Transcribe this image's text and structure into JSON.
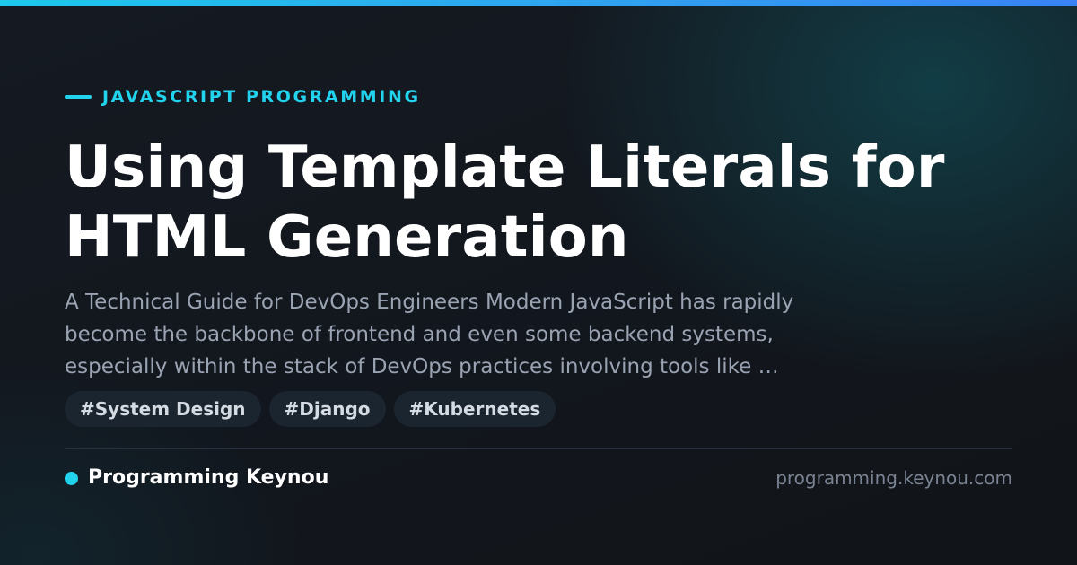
{
  "category": "JAVASCRIPT PROGRAMMING",
  "title_lines": [
    "Using Template Literals for",
    "HTML Generation"
  ],
  "excerpt_lines": [
    "A Technical Guide for DevOps Engineers Modern JavaScript has rapidly",
    "become the backbone of frontend and even some backend systems,",
    "especially within the stack of DevOps practices involving tools like …"
  ],
  "tags": [
    "#System Design",
    "#Django",
    "#Kubernetes"
  ],
  "brand": "Programming Keynou",
  "domain": "programming.keynou.com",
  "colors": {
    "accent": "#22d3ee",
    "background": "#13171f",
    "title": "#ffffff",
    "excerpt": "#9aa3b2",
    "tag_background": "#1b252f",
    "domain_text": "#7a8393"
  },
  "icons": {
    "category_marker": "dash-icon",
    "brand_marker": "dot-icon"
  }
}
